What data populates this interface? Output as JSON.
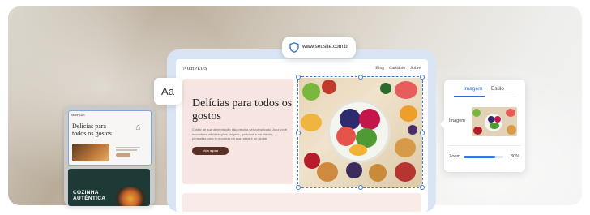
{
  "browser": {
    "url": "www.seusite.com.br"
  },
  "typography_chip": {
    "label": "Aa"
  },
  "site": {
    "brand": "NutriPLUS",
    "menu": [
      "Blog",
      "Cardápio",
      "Sobre"
    ],
    "hero": {
      "title": "Delícias para todos os gostos",
      "body": "Cuidar de sua alimentação não precisa ser complicado. Aqui você encontrará alimentações simples, gostosas e saudáveis, pensadas para te encaixar na sua rotina e no ajudar.",
      "cta": "Veja agora"
    }
  },
  "thumbnails": {
    "first": {
      "brand": "NutriPLUS",
      "title": "Delícias para todos os gostos"
    },
    "second": {
      "title_line1": "COZINHA",
      "title_line2": "AUTÊNTICA"
    }
  },
  "panel": {
    "tabs": [
      "Imagem",
      "Estilo"
    ],
    "active_tab": "Imagem",
    "image_label": "Imagem",
    "zoom_label": "Zoom",
    "zoom_value": "80%",
    "zoom_fraction": 0.8
  },
  "colors": {
    "accent": "#2d6fd0",
    "hero_bg": "#f6e5e1",
    "cta": "#5a2f26",
    "frame": "#d9e5f4"
  }
}
